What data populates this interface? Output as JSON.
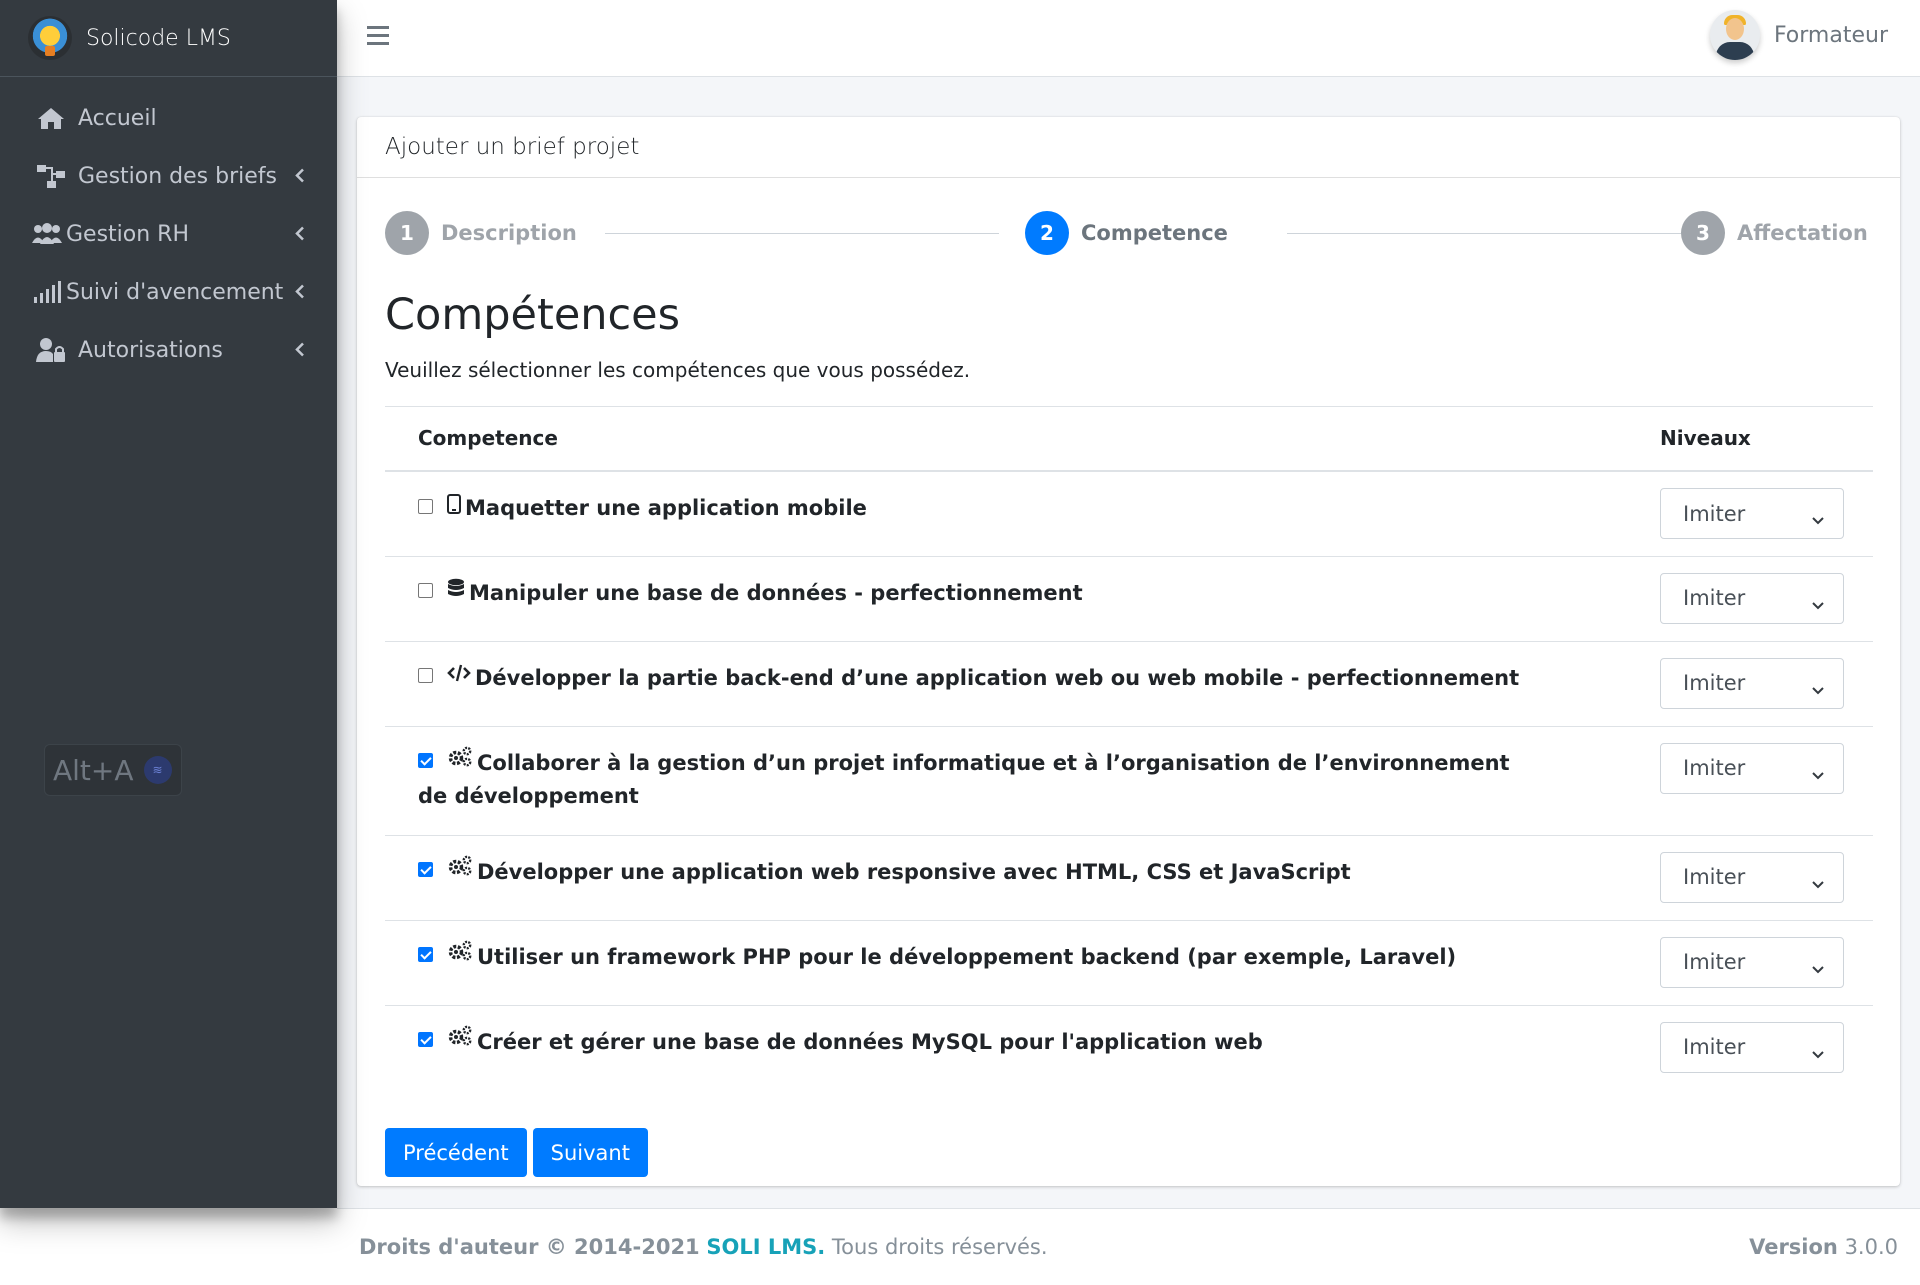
{
  "sidebar": {
    "brand": "Solicode LMS",
    "items": [
      {
        "label": "Accueil",
        "icon": "home-icon"
      },
      {
        "label": "Gestion des briefs",
        "icon": "sitemap-icon"
      },
      {
        "label": "Gestion RH",
        "icon": "users-icon"
      },
      {
        "label": "Suivi d'avencement",
        "icon": "signal-icon"
      },
      {
        "label": "Autorisations",
        "icon": "user-lock-icon"
      }
    ],
    "shortcut": "Alt+A"
  },
  "topbar": {
    "user_name": "Formateur"
  },
  "card": {
    "header": "Ajouter un brief projet",
    "steps": [
      {
        "number": "1",
        "label": "Description",
        "active": false
      },
      {
        "number": "2",
        "label": "Competence",
        "active": true
      },
      {
        "number": "3",
        "label": "Affectation",
        "active": false
      }
    ],
    "title": "Compétences",
    "subtitle": "Veuillez sélectionner les compétences que vous possédez.",
    "table": {
      "columns": [
        "Competence",
        "Niveaux"
      ],
      "rows": [
        {
          "icon": "mobile-icon",
          "checked": false,
          "label": "Maquetter une application mobile",
          "level": "Imiter"
        },
        {
          "icon": "database-icon",
          "checked": false,
          "label": "Manipuler une base de données - perfectionnement",
          "level": "Imiter"
        },
        {
          "icon": "code-icon",
          "checked": false,
          "label": "Développer la partie back-end d’une application web ou web mobile - perfectionnement",
          "level": "Imiter"
        },
        {
          "icon": "cogs-icon",
          "checked": true,
          "label": "Collaborer à la gestion d’un projet informatique et à l’organisation de l’environnement de développement",
          "level": "Imiter"
        },
        {
          "icon": "cogs-icon",
          "checked": true,
          "label": "Développer une application web responsive avec HTML, CSS et JavaScript",
          "level": "Imiter"
        },
        {
          "icon": "cogs-icon",
          "checked": true,
          "label": "Utiliser un framework PHP pour le développement backend (par exemple, Laravel)",
          "level": "Imiter"
        },
        {
          "icon": "cogs-icon",
          "checked": true,
          "label": "Créer et gérer une base de données MySQL pour l'application web",
          "level": "Imiter"
        }
      ]
    },
    "buttons": {
      "previous": "Précédent",
      "next": "Suivant"
    }
  },
  "footer": {
    "copyright": "Droits d'auteur © 2014-2021",
    "brand": "SOLI LMS.",
    "rights": "Tous droits réservés.",
    "version_label": "Version",
    "version": "3.0.0"
  },
  "colors": {
    "sidebar_bg": "#343a40",
    "primary": "#007bff",
    "content_bg": "#f4f6f9",
    "footer_brand": "#17a2b8"
  }
}
